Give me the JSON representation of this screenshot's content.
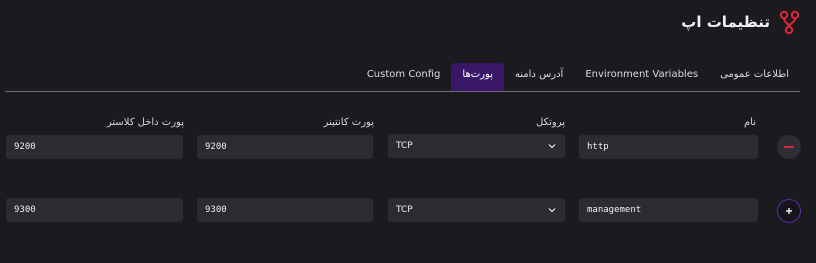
{
  "header": {
    "title": "تنظیمات اپ",
    "logo_icon": "fork-icon"
  },
  "tabs": [
    {
      "label": "اطلاعات عمومی",
      "active": false
    },
    {
      "label": "Environment Variables",
      "active": false
    },
    {
      "label": "آدرس دامنه",
      "active": false
    },
    {
      "label": "پورت‌ها",
      "active": true
    },
    {
      "label": "Custom Config",
      "active": false
    }
  ],
  "columns": {
    "name": "نام",
    "protocol": "پروتکل",
    "container_port": "پورت کانتینر",
    "cluster_port": "پورت داخل کلاستر"
  },
  "rows": [
    {
      "name": "http",
      "protocol": "TCP",
      "container_port": "9200",
      "cluster_port": "9200",
      "action": "remove",
      "action_symbol": "−"
    },
    {
      "name": "management",
      "protocol": "TCP",
      "container_port": "9300",
      "cluster_port": "9300",
      "action": "add",
      "action_symbol": "+"
    }
  ],
  "colors": {
    "accent": "#3a1666",
    "remove": "#e0263a",
    "add_border": "#5e2da8",
    "logo": "#e0263a"
  }
}
